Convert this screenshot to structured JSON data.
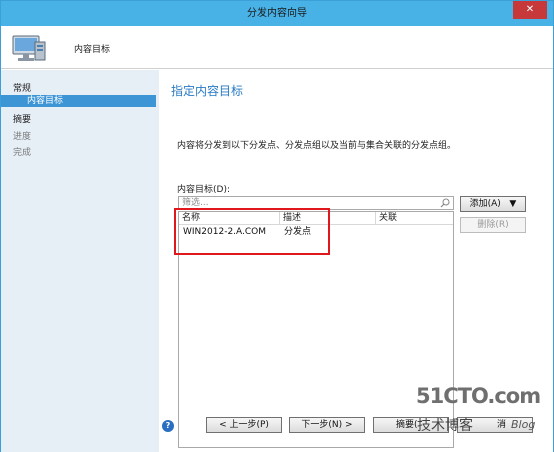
{
  "window": {
    "title": "分发内容向导",
    "close_label": "✕"
  },
  "header": {
    "title": "内容目标"
  },
  "sidebar": {
    "items": [
      {
        "label": "常规"
      },
      {
        "label": "内容目标"
      },
      {
        "label": "摘要"
      },
      {
        "label": "进度"
      },
      {
        "label": "完成"
      }
    ]
  },
  "main": {
    "section_title": "指定内容目标",
    "description": "内容将分发到以下分发点、分发点组以及当前与集合关联的分发点组。",
    "list_label": "内容目标(D):",
    "filter_placeholder": "筛选...",
    "columns": [
      "名称",
      "描述",
      "关联"
    ],
    "rows": [
      {
        "name": "WIN2012-2.A.COM",
        "desc": "分发点",
        "assoc": ""
      }
    ],
    "add_button": "添加(A)",
    "remove_button": "删除(R)"
  },
  "footer": {
    "help_label": "?",
    "back_button": "< 上一步(P)",
    "next_button": "下一步(N) >",
    "summary_button": "摘要(",
    "cancel_button": "消"
  },
  "watermark": {
    "brand": "51CTO.com",
    "sub": "技术博客",
    "blog": "Blog"
  },
  "colors": {
    "title_bar": "#48b1e6",
    "sidebar_bg": "#e6eef6",
    "selected": "#3e95d6",
    "section_title": "#2a7ac4",
    "highlight": "#e0171d"
  }
}
